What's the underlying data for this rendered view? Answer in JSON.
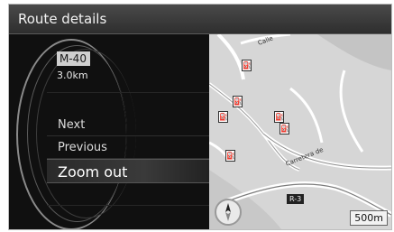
{
  "window": {
    "title": "Route details"
  },
  "route": {
    "road_name": "M-40",
    "distance": "3.0km"
  },
  "menu": {
    "items": [
      {
        "label": "Next",
        "selected": false
      },
      {
        "label": "Previous",
        "selected": false
      },
      {
        "label": "Zoom out",
        "selected": true
      }
    ]
  },
  "map": {
    "road_tag": "R-3",
    "scale": "500m",
    "poi_icon": "fuel-station-icon",
    "compass_icon": "compass-icon"
  },
  "colors": {
    "background": "#0f0f0f",
    "map_base": "#d6d6d6",
    "selection": "#3a3a3a"
  }
}
